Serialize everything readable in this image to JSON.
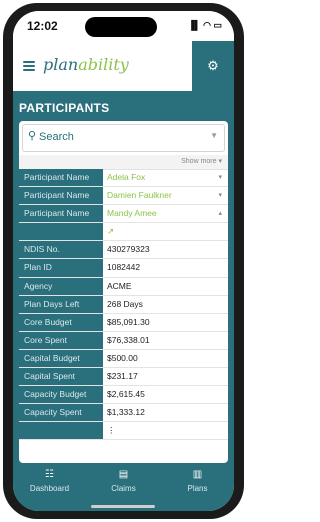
{
  "status": {
    "time": "12:02",
    "signal": "▐▌ ◠ ▭"
  },
  "header": {
    "logo_main": "plan",
    "logo_accent": "ability",
    "corner_icon": "settings-user-icon"
  },
  "section": {
    "title": "PARTICIPANTS"
  },
  "search": {
    "placeholder": "Search"
  },
  "show_more": "Show more ▾",
  "rows": [
    {
      "label": "Participant Name",
      "value": "Adela Fox",
      "green": true,
      "chevron": "▾"
    },
    {
      "label": "Participant Name",
      "value": "Damien Faulkner",
      "green": true,
      "chevron": "▾"
    },
    {
      "label": "Participant Name",
      "value": "Mandy Amee",
      "green": true,
      "chevron": "▴"
    },
    {
      "label": "",
      "value": "↗",
      "green": true,
      "chevron": ""
    },
    {
      "label": "NDIS No.",
      "value": "430279323"
    },
    {
      "label": "Plan ID",
      "value": "1082442"
    },
    {
      "label": "Agency",
      "value": "ACME"
    },
    {
      "label": "Plan Days Left",
      "value": "268 Days"
    },
    {
      "label": "Core Budget",
      "value": "$85,091.30"
    },
    {
      "label": "Core Spent",
      "value": "$76,338.01"
    },
    {
      "label": "Capital Budget",
      "value": "$500.00"
    },
    {
      "label": "Capital Spent",
      "value": "$231.17"
    },
    {
      "label": "Capacity Budget",
      "value": "$2,615.45"
    },
    {
      "label": "Capacity Spent",
      "value": "$1,333.12"
    },
    {
      "label": "",
      "value": "⋮"
    }
  ],
  "bottom_nav": [
    {
      "label": "Dashboard",
      "icon": "dashboard-icon",
      "glyph": "☷"
    },
    {
      "label": "Claims",
      "icon": "claims-icon",
      "glyph": "▤"
    },
    {
      "label": "Plans",
      "icon": "plans-icon",
      "glyph": "▥"
    }
  ],
  "colors": {
    "primary": "#2a6f7c",
    "accent": "#8bc34a"
  }
}
